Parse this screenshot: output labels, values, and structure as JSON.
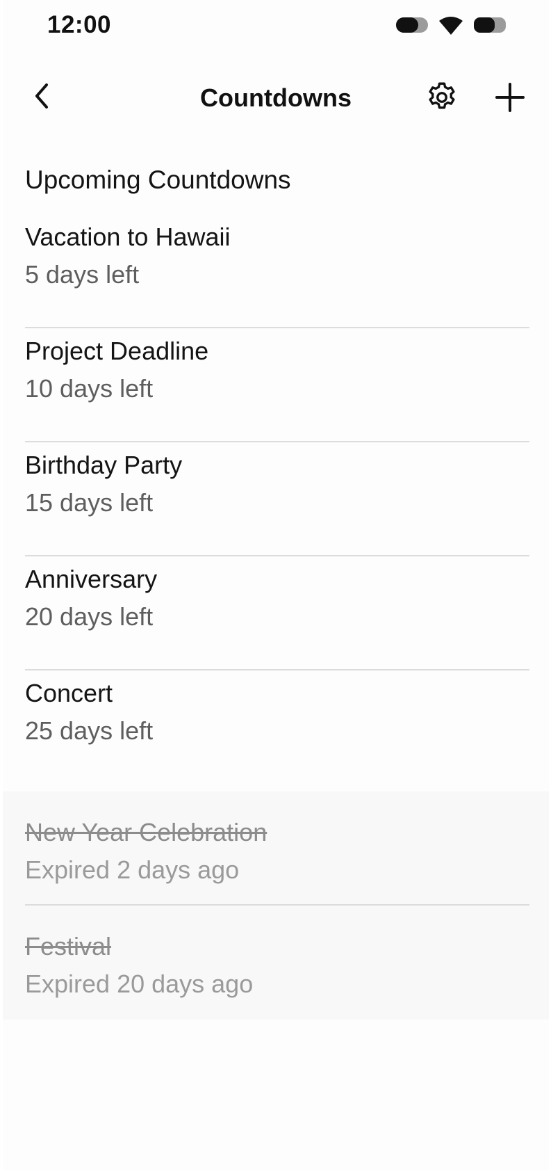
{
  "status_bar": {
    "time": "12:00",
    "icons": [
      "toggle-icon",
      "wifi-icon",
      "battery-icon"
    ]
  },
  "header": {
    "title": "Countdowns",
    "back_icon": "chevron-left-icon",
    "settings_icon": "gear-icon",
    "add_icon": "plus-icon"
  },
  "section": {
    "title": "Upcoming Countdowns"
  },
  "upcoming": [
    {
      "name": "Vacation to Hawaii",
      "remaining": "5 days left"
    },
    {
      "name": "Project Deadline",
      "remaining": "10 days left"
    },
    {
      "name": "Birthday Party",
      "remaining": "15 days left"
    },
    {
      "name": "Anniversary",
      "remaining": "20 days left"
    },
    {
      "name": "Concert",
      "remaining": "25 days left"
    }
  ],
  "expired": [
    {
      "name": "New Year Celebration",
      "remaining": "Expired 2 days ago"
    },
    {
      "name": "Festival",
      "remaining": "Expired 20 days ago"
    }
  ],
  "colors": {
    "text_primary": "#141414",
    "text_secondary": "#5e5e5e",
    "text_expired": "#8c8c8c",
    "expired_background": "#f8f8f8",
    "divider": "#dcdcdc"
  }
}
